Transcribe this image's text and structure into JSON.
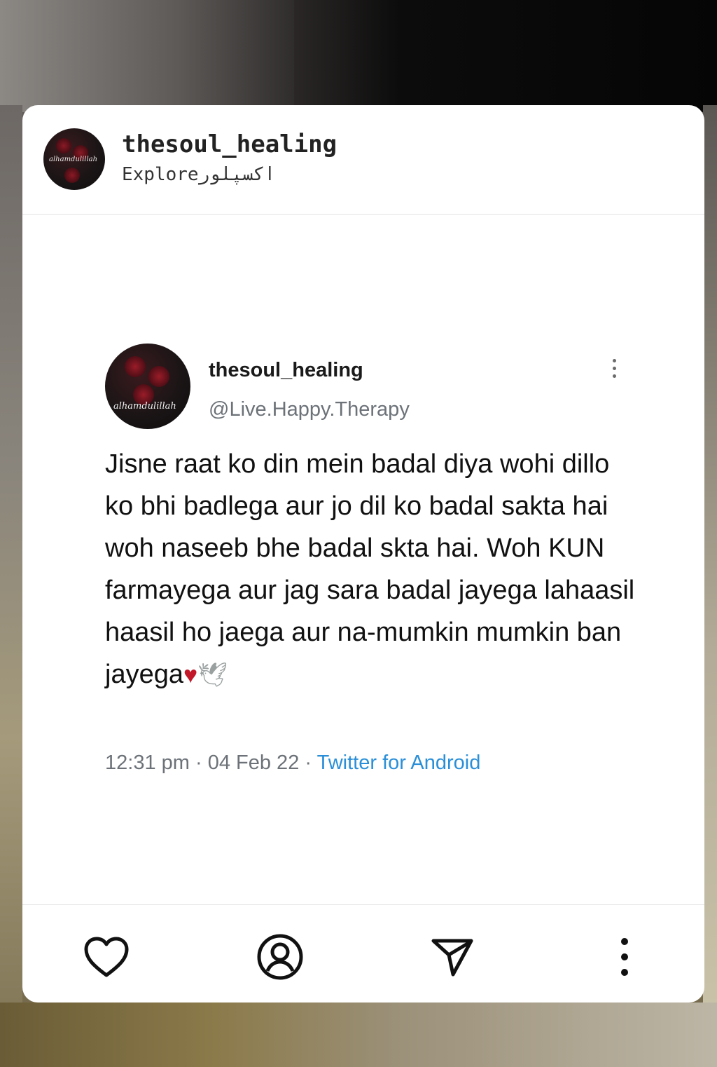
{
  "post": {
    "username": "thesoul_healing",
    "subtitle": "Exploreاکسپلور"
  },
  "tweet": {
    "name": "thesoul_healing",
    "handle": "@Live.Happy.Therapy",
    "text": "Jisne raat ko din mein badal diya wohi dillo ko bhi badlega aur jo dil ko badal sakta hai woh naseeb bhe badal skta hai. Woh KUN farmayega aur jag sara badal jayega lahaasil haasil ho jaega aur na-mumkin mumkin ban jayega",
    "emoji_heart": "♥",
    "emoji_dove": "🕊",
    "time": "12:31 pm",
    "date": "04 Feb 22",
    "separator": "·",
    "source": "Twitter for Android",
    "avatar_script": "alhamdulillah"
  },
  "actions": [
    {
      "name": "like",
      "icon": "heart-icon"
    },
    {
      "name": "profile",
      "icon": "user-circle-icon"
    },
    {
      "name": "share",
      "icon": "send-icon"
    },
    {
      "name": "more",
      "icon": "more-vertical-icon"
    }
  ],
  "colors": {
    "link": "#2a8fd8",
    "heart": "#c2182a",
    "meta": "#6c7278"
  }
}
